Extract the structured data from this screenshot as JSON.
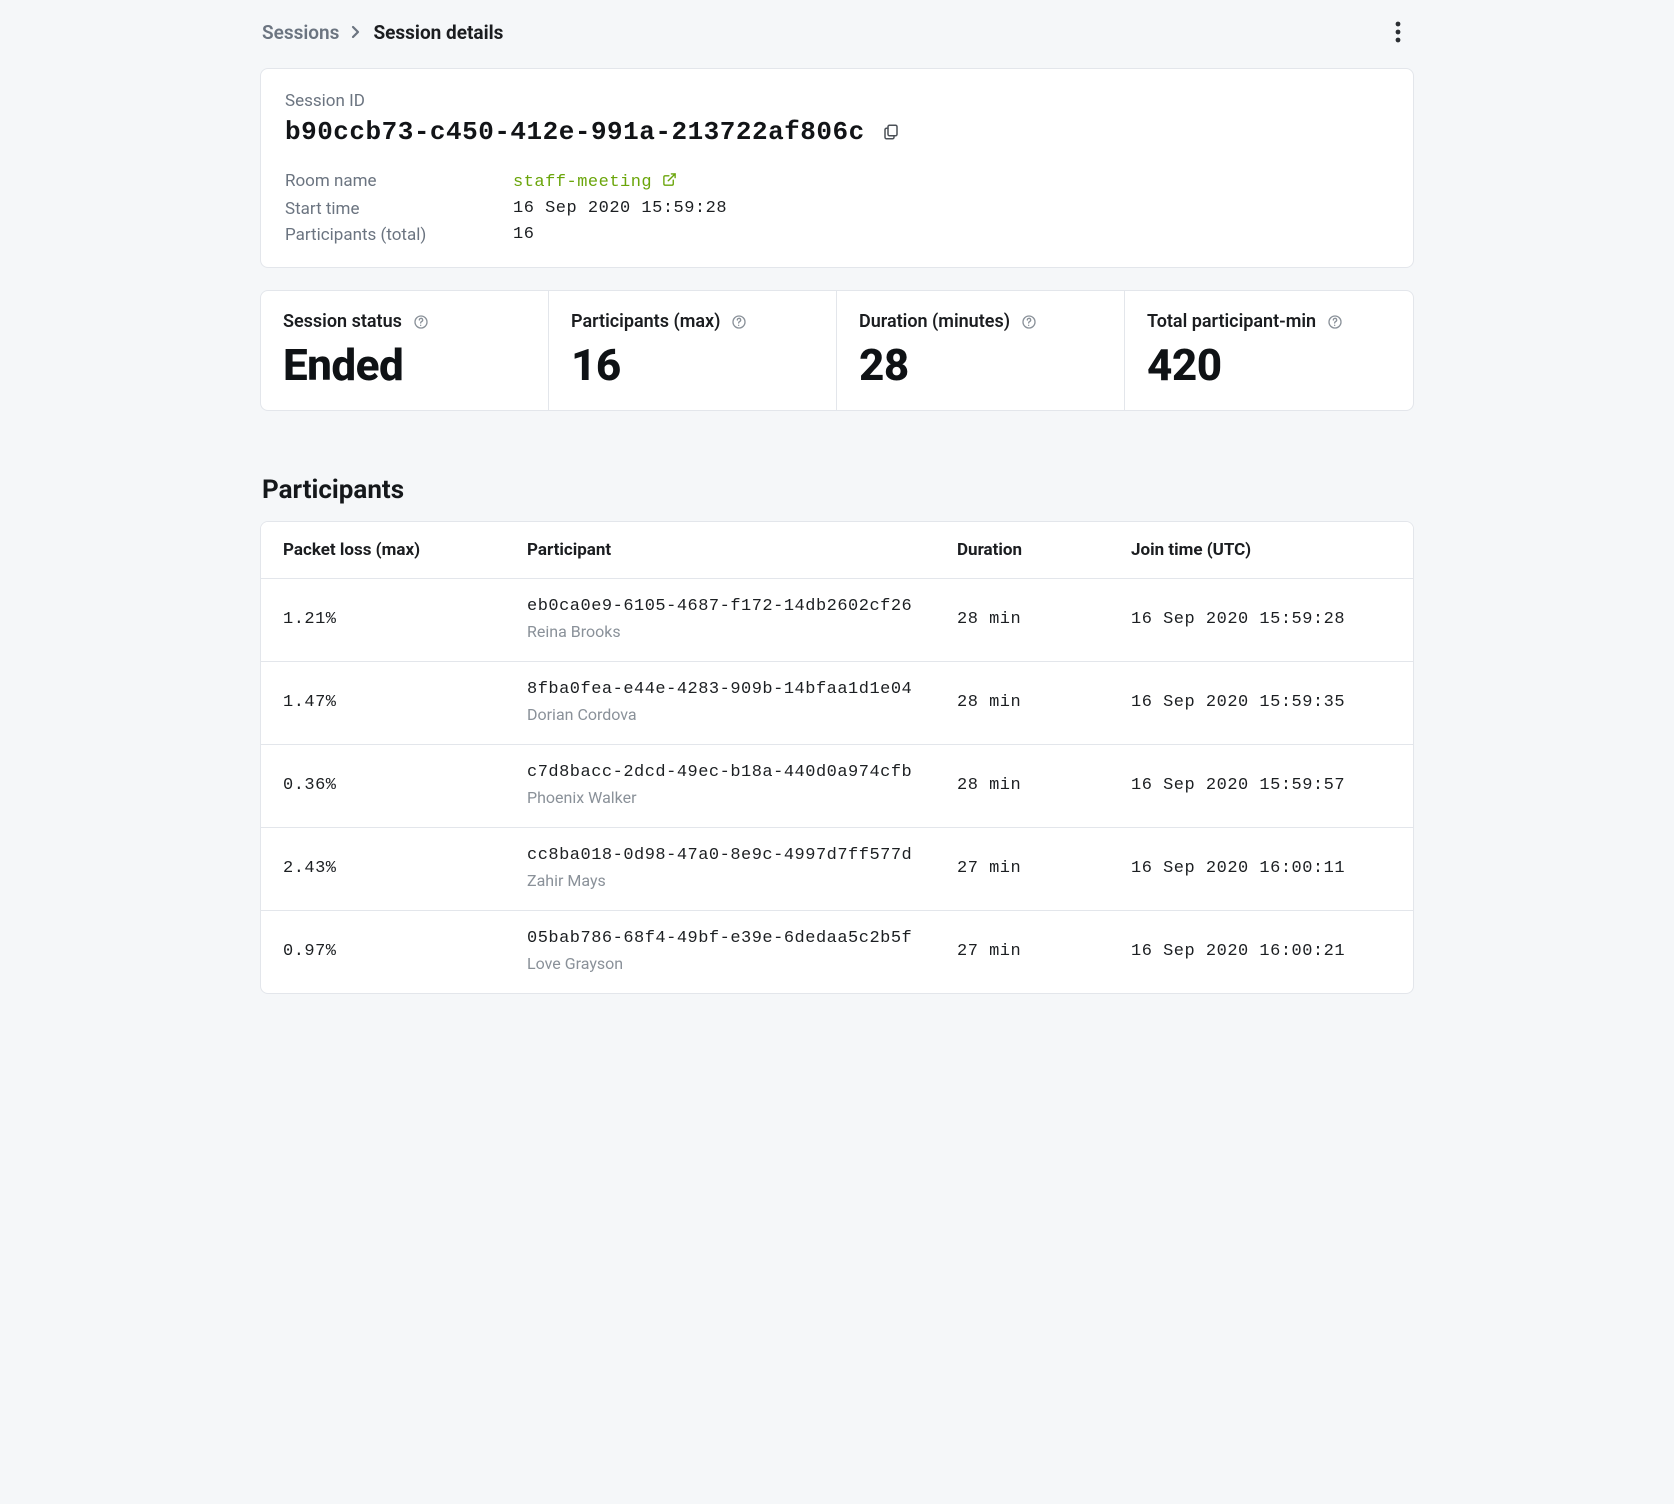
{
  "breadcrumb": {
    "root": "Sessions",
    "current": "Session details"
  },
  "session": {
    "id_label": "Session ID",
    "id": "b90ccb73-c450-412e-991a-213722af806c",
    "room_label": "Room name",
    "room_name": "staff-meeting",
    "start_label": "Start time",
    "start_time": "16 Sep 2020 15:59:28",
    "participants_total_label": "Participants (total)",
    "participants_total": "16"
  },
  "stats": [
    {
      "label": "Session status",
      "value": "Ended"
    },
    {
      "label": "Participants (max)",
      "value": "16"
    },
    {
      "label": "Duration (minutes)",
      "value": "28"
    },
    {
      "label": "Total participant-min",
      "value": "420"
    }
  ],
  "participants_section": {
    "title": "Participants",
    "columns": {
      "packet_loss": "Packet loss (max)",
      "participant": "Participant",
      "duration": "Duration",
      "join_time": "Join time (UTC)"
    },
    "rows": [
      {
        "packet_loss": "1.21%",
        "id": "eb0ca0e9-6105-4687-f172-14db2602cf26",
        "name": "Reina Brooks",
        "duration": "28 min",
        "join_time": "16 Sep 2020 15:59:28"
      },
      {
        "packet_loss": "1.47%",
        "id": "8fba0fea-e44e-4283-909b-14bfaa1d1e04",
        "name": "Dorian Cordova",
        "duration": "28 min",
        "join_time": "16 Sep 2020 15:59:35"
      },
      {
        "packet_loss": "0.36%",
        "id": "c7d8bacc-2dcd-49ec-b18a-440d0a974cfb",
        "name": "Phoenix Walker",
        "duration": "28 min",
        "join_time": "16 Sep 2020 15:59:57"
      },
      {
        "packet_loss": "2.43%",
        "id": "cc8ba018-0d98-47a0-8e9c-4997d7ff577d",
        "name": "Zahir Mays",
        "duration": "27 min",
        "join_time": "16 Sep 2020 16:00:11"
      },
      {
        "packet_loss": "0.97%",
        "id": "05bab786-68f4-49bf-e39e-6dedaa5c2b5f",
        "name": "Love Grayson",
        "duration": "27 min",
        "join_time": "16 Sep 2020 16:00:21"
      }
    ]
  }
}
